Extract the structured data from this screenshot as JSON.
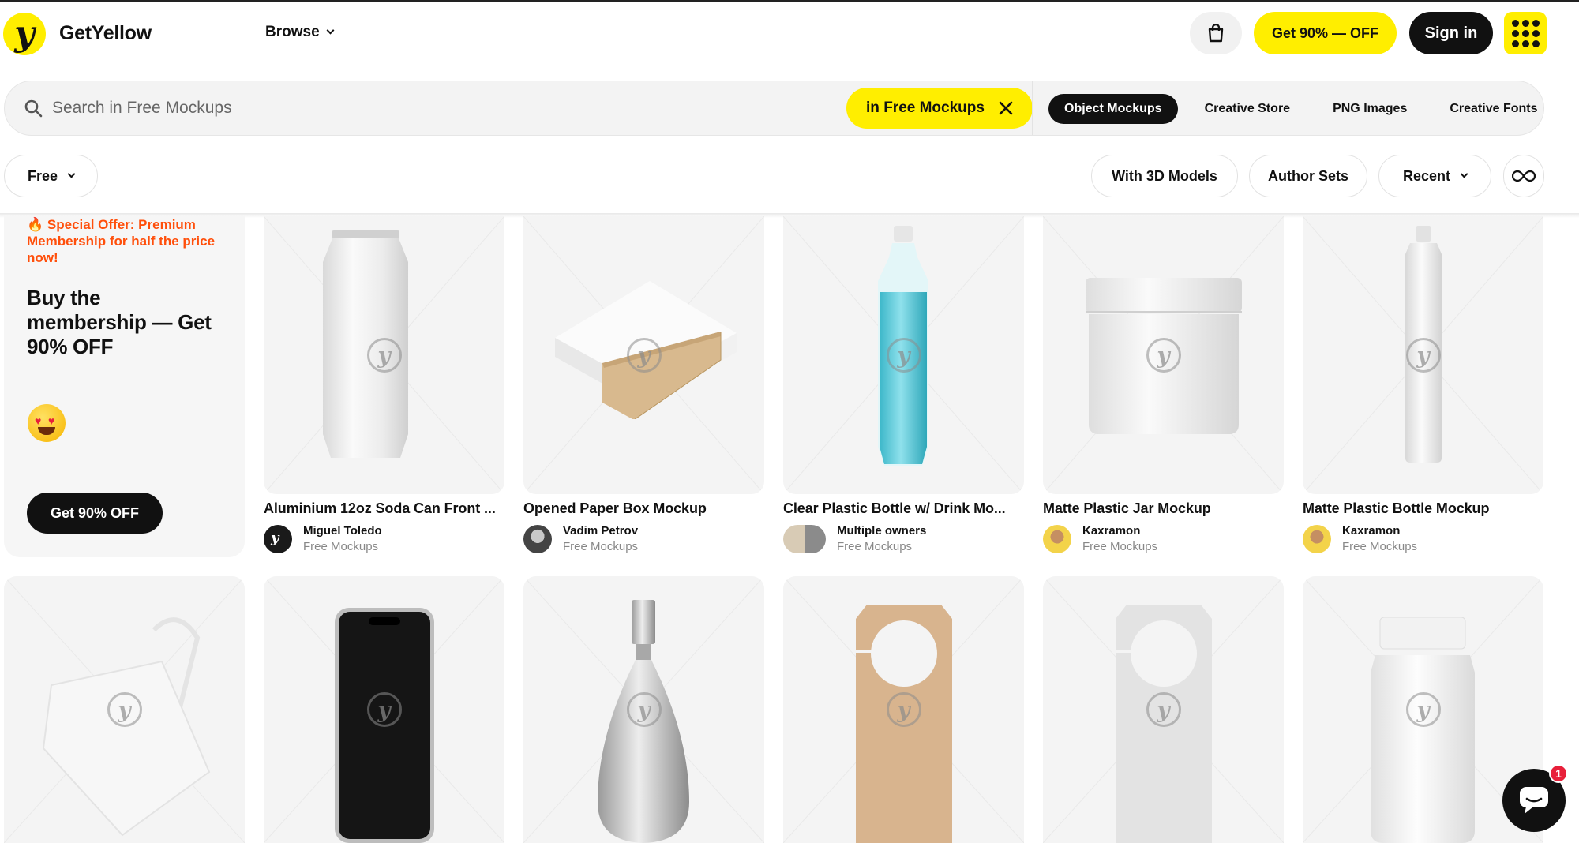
{
  "header": {
    "logo_glyph": "y",
    "brand": "GetYellow",
    "browse_label": "Browse",
    "deal_label": "Get 90% — OFF",
    "signin_label": "Sign in",
    "cart_icon": "shopping-bag-icon",
    "apps_icon": "grid-dots-icon",
    "accent": "#ffee00"
  },
  "search": {
    "placeholder": "Search in Free Mockups",
    "value": "",
    "scope_label": "in Free Mockups",
    "categories": [
      {
        "label": "Object Mockups",
        "active": true
      },
      {
        "label": "Creative Store",
        "active": false
      },
      {
        "label": "PNG Images",
        "active": false
      },
      {
        "label": "Creative Fonts",
        "active": false
      }
    ]
  },
  "filters": {
    "price": "Free",
    "with_3d": "With 3D Models",
    "author_sets": "Author Sets",
    "sort": "Recent",
    "loop_icon": "infinity-icon"
  },
  "promo": {
    "offer_icon": "fire-icon",
    "offer_text": "Special Offer: Premium Membership for half the price now!",
    "headline": "Buy the membership — Get 90% OFF",
    "emoji": "heart-eyes-emoji",
    "button_label": "Get 90% OFF",
    "offer_color": "#ff4f0b"
  },
  "items": [
    {
      "title": "Aluminium 12oz Soda Can Front ...",
      "author": "Miguel Toledo",
      "source": "Free Mockups"
    },
    {
      "title": "Opened Paper Box Mockup",
      "author": "Vadim Petrov",
      "source": "Free Mockups"
    },
    {
      "title": "Clear Plastic Bottle w/ Drink Mo...",
      "author": "Multiple owners",
      "source": "Free Mockups"
    },
    {
      "title": "Matte Plastic Jar Mockup",
      "author": "Kaxramon",
      "source": "Free Mockups"
    },
    {
      "title": "Matte Plastic Bottle Mockup",
      "author": "Kaxramon",
      "source": "Free Mockups"
    }
  ],
  "second_row": [
    "tote-bag",
    "smartphone",
    "perfume-bottle",
    "kraft-door-hanger",
    "white-door-hanger",
    "pill-bottle"
  ],
  "chat": {
    "badge_count": "1",
    "icon": "chat-bubble-icon"
  }
}
